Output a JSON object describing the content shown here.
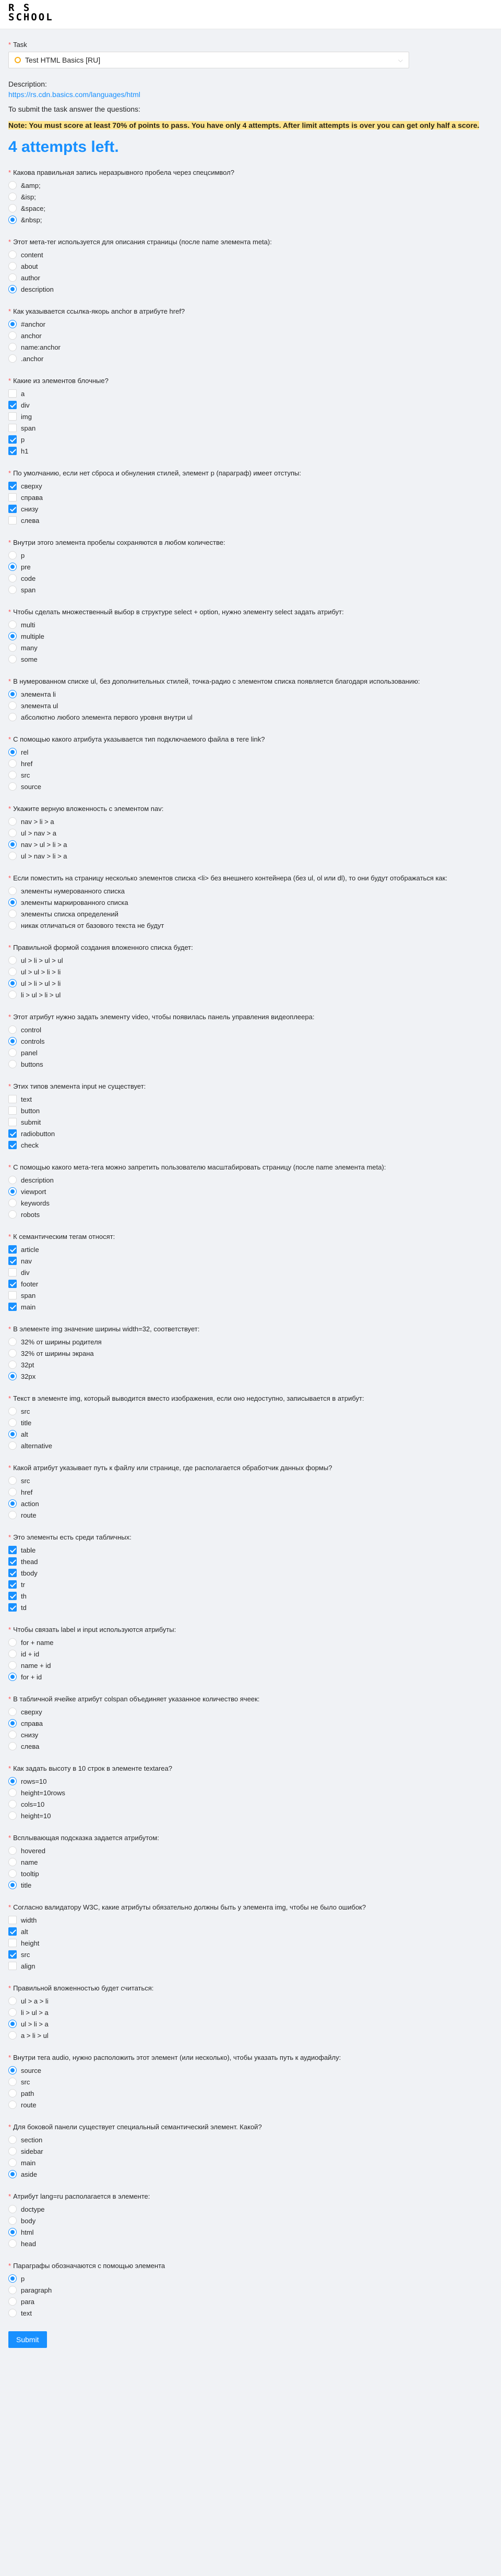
{
  "logo": {
    "line1": "R S",
    "line2": "SCHOOL"
  },
  "task": {
    "label": "Task",
    "selected": "Test HTML Basics [RU]",
    "status_color": "#faad14"
  },
  "description": {
    "label": "Description:",
    "link": "https://rs.cdn.basics.com/languages/html"
  },
  "instruction": "To submit the task answer the questions:",
  "note": "Note: You must score at least 70% of points to pass. You have only 4 attempts. After limit attempts is over you can get only half a score.",
  "attempts": "4 attempts left.",
  "submit_label": "Submit",
  "accent_color": "#1890ff",
  "questions": [
    {
      "title": "Какова правильная запись неразрывного пробела через спецсимвол?",
      "type": "radio",
      "options": [
        {
          "label": "&amp;",
          "checked": false
        },
        {
          "label": "&isp;",
          "checked": false
        },
        {
          "label": "&space;",
          "checked": false
        },
        {
          "label": "&nbsp;",
          "checked": true
        }
      ]
    },
    {
      "title": "Этот мета-тег используется для описания страницы (после name элемента meta):",
      "type": "radio",
      "options": [
        {
          "label": "content",
          "checked": false
        },
        {
          "label": "about",
          "checked": false
        },
        {
          "label": "author",
          "checked": false
        },
        {
          "label": "description",
          "checked": true
        }
      ]
    },
    {
      "title": "Как указывается ссылка-якорь anchor в атрибуте href?",
      "type": "radio",
      "options": [
        {
          "label": "#anchor",
          "checked": true
        },
        {
          "label": "anchor",
          "checked": false
        },
        {
          "label": "name:anchor",
          "checked": false
        },
        {
          "label": ".anchor",
          "checked": false
        }
      ]
    },
    {
      "title": "Какие из элементов блочные?",
      "type": "checkbox",
      "options": [
        {
          "label": "a",
          "checked": false
        },
        {
          "label": "div",
          "checked": true
        },
        {
          "label": "img",
          "checked": false
        },
        {
          "label": "span",
          "checked": false
        },
        {
          "label": "p",
          "checked": true
        },
        {
          "label": "h1",
          "checked": true
        }
      ]
    },
    {
      "title": "По умолчанию, если нет сброса и обнуления стилей, элемент p (параграф) имеет отступы:",
      "type": "checkbox",
      "options": [
        {
          "label": "сверху",
          "checked": true
        },
        {
          "label": "справа",
          "checked": false
        },
        {
          "label": "снизу",
          "checked": true
        },
        {
          "label": "слева",
          "checked": false
        }
      ]
    },
    {
      "title": "Внутри этого элемента пробелы сохраняются в любом количестве:",
      "type": "radio",
      "options": [
        {
          "label": "p",
          "checked": false
        },
        {
          "label": "pre",
          "checked": true
        },
        {
          "label": "code",
          "checked": false
        },
        {
          "label": "span",
          "checked": false
        }
      ]
    },
    {
      "title": "Чтобы сделать множественный выбор в структуре select + option, нужно элементу select задать атрибут:",
      "type": "radio",
      "options": [
        {
          "label": "multi",
          "checked": false
        },
        {
          "label": "multiple",
          "checked": true
        },
        {
          "label": "many",
          "checked": false
        },
        {
          "label": "some",
          "checked": false
        }
      ]
    },
    {
      "title": "В нумерованном списке ul, без дополнительных стилей, точка-радио с элементом списка появляется благодаря использованию:",
      "type": "radio",
      "options": [
        {
          "label": "элемента li",
          "checked": true
        },
        {
          "label": "элемента ul",
          "checked": false
        },
        {
          "label": "абсолютно любого элемента первого уровня внутри ul",
          "checked": false
        }
      ]
    },
    {
      "title": "С помощью какого атрибута указывается тип подключаемого файла в теге link?",
      "type": "radio",
      "options": [
        {
          "label": "rel",
          "checked": true
        },
        {
          "label": "href",
          "checked": false
        },
        {
          "label": "src",
          "checked": false
        },
        {
          "label": "source",
          "checked": false
        }
      ]
    },
    {
      "title": "Укажите верную вложенность с элементом nav:",
      "type": "radio",
      "options": [
        {
          "label": "nav > li > a",
          "checked": false
        },
        {
          "label": "ul > nav > a",
          "checked": false
        },
        {
          "label": "nav > ul > li > a",
          "checked": true
        },
        {
          "label": "ul > nav > li > a",
          "checked": false
        }
      ]
    },
    {
      "title": "Если поместить на страницу несколько элементов списка <li> без внешнего контейнера (без ul, ol или dl), то они будут отображаться как:",
      "type": "radio",
      "options": [
        {
          "label": "элементы нумерованного списка",
          "checked": false
        },
        {
          "label": "элементы маркированного списка",
          "checked": true
        },
        {
          "label": "элементы списка определений",
          "checked": false
        },
        {
          "label": "никак отличаться от базового текста не будут",
          "checked": false
        }
      ]
    },
    {
      "title": "Правильной формой создания вложенного списка будет:",
      "type": "radio",
      "options": [
        {
          "label": "ul > li > ul > ul",
          "checked": false
        },
        {
          "label": "ul > ul > li > li",
          "checked": false
        },
        {
          "label": "ul > li > ul > li",
          "checked": true
        },
        {
          "label": "li > ul > li > ul",
          "checked": false
        }
      ]
    },
    {
      "title": "Этот атрибут нужно задать элементу video, чтобы появилась панель управления видеоплеера:",
      "type": "radio",
      "options": [
        {
          "label": "control",
          "checked": false
        },
        {
          "label": "controls",
          "checked": true
        },
        {
          "label": "panel",
          "checked": false
        },
        {
          "label": "buttons",
          "checked": false
        }
      ]
    },
    {
      "title": "Этих типов элемента input не существует:",
      "type": "checkbox",
      "options": [
        {
          "label": "text",
          "checked": false
        },
        {
          "label": "button",
          "checked": false
        },
        {
          "label": "submit",
          "checked": false
        },
        {
          "label": "radiobutton",
          "checked": true
        },
        {
          "label": "check",
          "checked": true
        }
      ]
    },
    {
      "title": "С помощью какого мета-тега можно запретить пользователю масштабировать страницу (после name элемента meta):",
      "type": "radio",
      "options": [
        {
          "label": "description",
          "checked": false
        },
        {
          "label": "viewport",
          "checked": true
        },
        {
          "label": "keywords",
          "checked": false
        },
        {
          "label": "robots",
          "checked": false
        }
      ]
    },
    {
      "title": "К семантическим тегам относят:",
      "type": "checkbox",
      "options": [
        {
          "label": "article",
          "checked": true
        },
        {
          "label": "nav",
          "checked": true
        },
        {
          "label": "div",
          "checked": false
        },
        {
          "label": "footer",
          "checked": true
        },
        {
          "label": "span",
          "checked": false
        },
        {
          "label": "main",
          "checked": true
        }
      ]
    },
    {
      "title": "В элементе img значение ширины width=32, соответствует:",
      "type": "radio",
      "options": [
        {
          "label": "32% от ширины родителя",
          "checked": false
        },
        {
          "label": "32% от ширины экрана",
          "checked": false
        },
        {
          "label": "32pt",
          "checked": false
        },
        {
          "label": "32px",
          "checked": true
        }
      ]
    },
    {
      "title": "Текст в элементе img, который выводится вместо изображения, если оно недоступно, записывается в атрибут:",
      "type": "radio",
      "options": [
        {
          "label": "src",
          "checked": false
        },
        {
          "label": "title",
          "checked": false
        },
        {
          "label": "alt",
          "checked": true
        },
        {
          "label": "alternative",
          "checked": false
        }
      ]
    },
    {
      "title": "Какой атрибут указывает путь к файлу или странице, где располагается обработчик данных формы?",
      "type": "radio",
      "options": [
        {
          "label": "src",
          "checked": false
        },
        {
          "label": "href",
          "checked": false
        },
        {
          "label": "action",
          "checked": true
        },
        {
          "label": "route",
          "checked": false
        }
      ]
    },
    {
      "title": "Это элементы есть среди табличных:",
      "type": "checkbox",
      "options": [
        {
          "label": "table",
          "checked": true
        },
        {
          "label": "thead",
          "checked": true
        },
        {
          "label": "tbody",
          "checked": true
        },
        {
          "label": "tr",
          "checked": true
        },
        {
          "label": "th",
          "checked": true
        },
        {
          "label": "td",
          "checked": true
        }
      ]
    },
    {
      "title": "Чтобы связать label и input используются атрибуты:",
      "type": "radio",
      "options": [
        {
          "label": "for + name",
          "checked": false
        },
        {
          "label": "id + id",
          "checked": false
        },
        {
          "label": "name + id",
          "checked": false
        },
        {
          "label": "for + id",
          "checked": true
        }
      ]
    },
    {
      "title": "В табличной ячейке атрибут colspan объединяет указанное количество ячеек:",
      "type": "radio",
      "options": [
        {
          "label": "сверху",
          "checked": false
        },
        {
          "label": "справа",
          "checked": true
        },
        {
          "label": "снизу",
          "checked": false
        },
        {
          "label": "слева",
          "checked": false
        }
      ]
    },
    {
      "title": "Как задать высоту в 10 строк в элементе textarea?",
      "type": "radio",
      "options": [
        {
          "label": "rows=10",
          "checked": true
        },
        {
          "label": "height=10rows",
          "checked": false
        },
        {
          "label": "cols=10",
          "checked": false
        },
        {
          "label": "height=10",
          "checked": false
        }
      ]
    },
    {
      "title": "Всплывающая подсказка задается атрибутом:",
      "type": "radio",
      "options": [
        {
          "label": "hovered",
          "checked": false
        },
        {
          "label": "name",
          "checked": false
        },
        {
          "label": "tooltip",
          "checked": false
        },
        {
          "label": "title",
          "checked": true
        }
      ]
    },
    {
      "title": "Согласно валидатору W3C, какие атрибуты обязательно должны быть у элемента img, чтобы не было ошибок?",
      "type": "checkbox",
      "options": [
        {
          "label": "width",
          "checked": false
        },
        {
          "label": "alt",
          "checked": true
        },
        {
          "label": "height",
          "checked": false
        },
        {
          "label": "src",
          "checked": true
        },
        {
          "label": "align",
          "checked": false
        }
      ]
    },
    {
      "title": "Правильной вложенностью будет считаться:",
      "type": "radio",
      "options": [
        {
          "label": "ul > a > li",
          "checked": false
        },
        {
          "label": "li > ul > a",
          "checked": false
        },
        {
          "label": "ul > li > a",
          "checked": true
        },
        {
          "label": "a > li > ul",
          "checked": false
        }
      ]
    },
    {
      "title": "Внутри тега audio, нужно расположить этот элемент (или несколько), чтобы указать путь к аудиофайлу:",
      "type": "radio",
      "options": [
        {
          "label": "source",
          "checked": true
        },
        {
          "label": "src",
          "checked": false
        },
        {
          "label": "path",
          "checked": false
        },
        {
          "label": "route",
          "checked": false
        }
      ]
    },
    {
      "title": "Для боковой панели существует специальный семантический элемент. Какой?",
      "type": "radio",
      "options": [
        {
          "label": "section",
          "checked": false
        },
        {
          "label": "sidebar",
          "checked": false
        },
        {
          "label": "main",
          "checked": false
        },
        {
          "label": "aside",
          "checked": true
        }
      ]
    },
    {
      "title": "Атрибут lang=ru располагается в элементе:",
      "type": "radio",
      "options": [
        {
          "label": "doctype",
          "checked": false
        },
        {
          "label": "body",
          "checked": false
        },
        {
          "label": "html",
          "checked": true
        },
        {
          "label": "head",
          "checked": false
        }
      ]
    },
    {
      "title": "Параграфы обозначаются с помощью элемента",
      "type": "radio",
      "options": [
        {
          "label": "p",
          "checked": true
        },
        {
          "label": "paragraph",
          "checked": false
        },
        {
          "label": "para",
          "checked": false
        },
        {
          "label": "text",
          "checked": false
        }
      ]
    }
  ]
}
